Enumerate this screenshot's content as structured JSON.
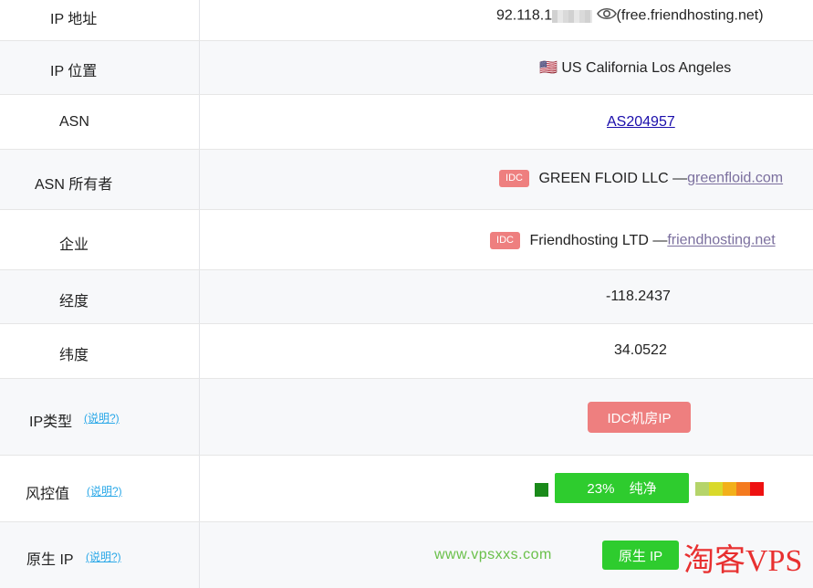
{
  "rows": {
    "ip_address": {
      "label": "IP 地址",
      "ip_partial": "92.118.1",
      "host": "(free.friendhosting.net)"
    },
    "ip_location": {
      "label": "IP 位置",
      "flag": "🇺🇸",
      "value": "US California Los Angeles"
    },
    "asn": {
      "label": "ASN",
      "value": "AS204957"
    },
    "asn_owner": {
      "label": "ASN 所有者",
      "tag": "IDC",
      "name": "GREEN FLOID LLC —",
      "link": "greenfloid.com"
    },
    "company": {
      "label": "企业",
      "tag": "IDC",
      "name": "Friendhosting LTD —",
      "link": "friendhosting.net"
    },
    "longitude": {
      "label": "经度",
      "value": "-118.2437"
    },
    "latitude": {
      "label": "纬度",
      "value": "34.0522"
    },
    "ip_type": {
      "label": "IP类型",
      "help": "(说明?)",
      "value": "IDC机房IP"
    },
    "risk": {
      "label": "风控值",
      "help": "(说明?)",
      "value": "23%  纯净",
      "scale_colors": [
        "#b5d46a",
        "#d9d92b",
        "#f2b01a",
        "#f47a1f",
        "#ee1111"
      ]
    },
    "native_ip": {
      "label": "原生 IP",
      "help": "(说明?)",
      "value": "原生 IP"
    }
  },
  "watermark": {
    "site": "www.vpsxxs.com",
    "logo": "淘客VPS"
  },
  "colors": {
    "idc_red": "#ee7f7f",
    "pure_green": "#2ecc2e",
    "help_blue": "#2aa8e8"
  }
}
